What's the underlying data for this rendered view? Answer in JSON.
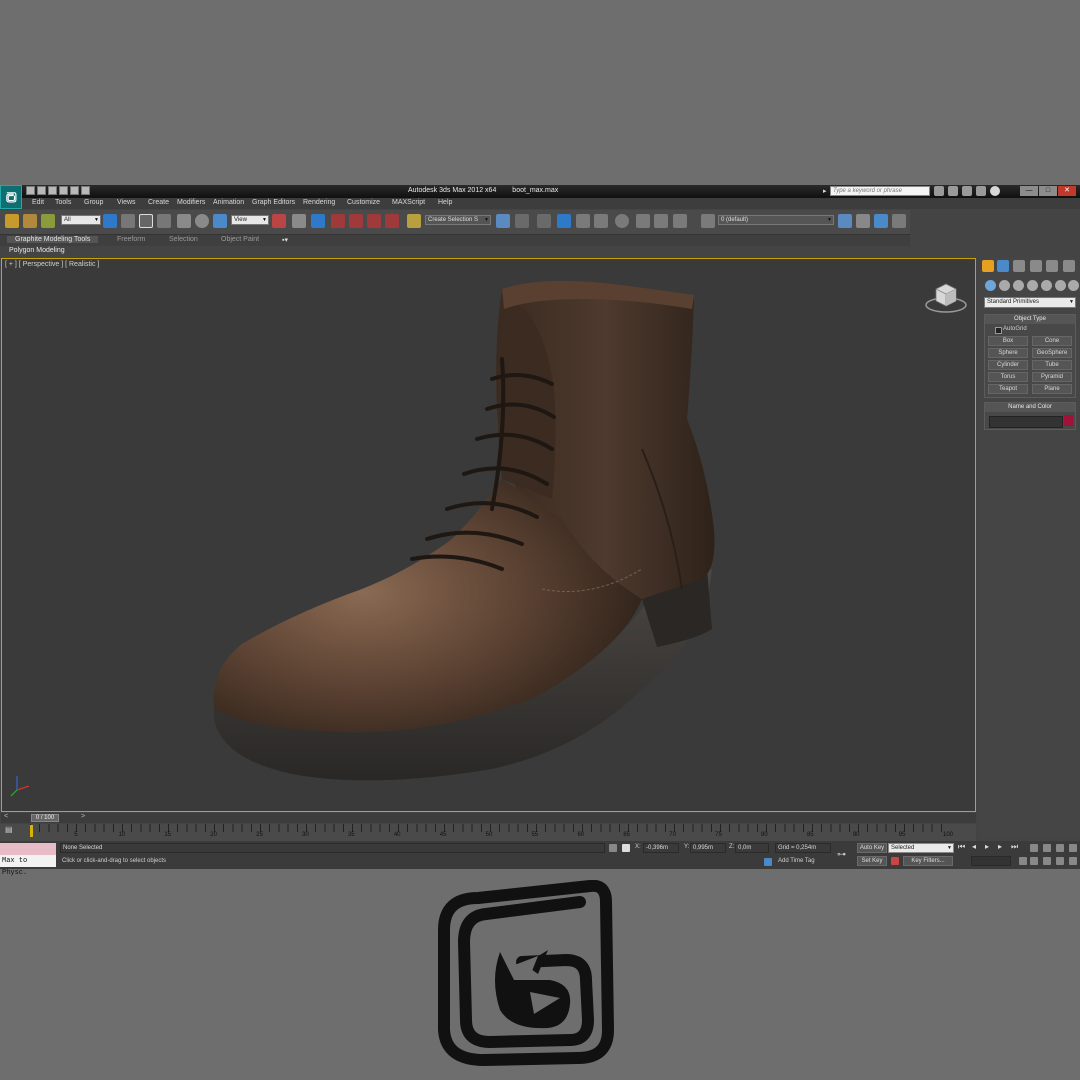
{
  "window": {
    "app_title": "Autodesk 3ds Max  2012 x64",
    "file_name": "boot_max.max",
    "search_placeholder": "Type a keyword or phrase",
    "minimize": "—",
    "maximize": "□",
    "close": "✕"
  },
  "menu": [
    "Edit",
    "Tools",
    "Group",
    "Views",
    "Create",
    "Modifiers",
    "Animation",
    "Graph Editors",
    "Rendering",
    "Customize",
    "MAXScript",
    "Help"
  ],
  "toolbar": {
    "selection_filter": "All",
    "reference_coord": "View",
    "named_selection": "Create Selection S",
    "layer": "0 (default)"
  },
  "ribbon": {
    "tabs": [
      "Graphite Modeling Tools",
      "Freeform",
      "Selection",
      "Object Paint"
    ],
    "panel_label": "Polygon Modeling"
  },
  "viewport": {
    "label": "[ + ] [ Perspective ] [ Realistic ]"
  },
  "command_panel": {
    "category": "Standard Primitives",
    "object_type_title": "Object Type",
    "autogrid_label": "AutoGrid",
    "objects": [
      "Box",
      "Cone",
      "Sphere",
      "GeoSphere",
      "Cylinder",
      "Tube",
      "Torus",
      "Pyramid",
      "Teapot",
      "Plane"
    ],
    "name_color_title": "Name and Color",
    "object_color": "#a0123a"
  },
  "timeline": {
    "frame_display": "0 / 100",
    "prev": "<",
    "next": ">",
    "ticks": [
      "5",
      "10",
      "15",
      "20",
      "25",
      "30",
      "35",
      "40",
      "45",
      "50",
      "55",
      "60",
      "65",
      "70",
      "75",
      "80",
      "85",
      "90",
      "95",
      "100"
    ]
  },
  "status": {
    "listener_text": "Max to Physc.",
    "selection_status": "None Selected",
    "prompt": "Click or click-and-drag to select objects",
    "x_label": "X:",
    "x_value": "-0,396m",
    "y_label": "Y:",
    "y_value": "0,995m",
    "z_label": "Z:",
    "z_value": "0,0m",
    "grid": "Grid = 0,254m",
    "add_time_tag": "Add Time Tag",
    "auto_key": "Auto Key",
    "set_key": "Set Key",
    "key_mode": "Selected",
    "key_filters": "Key Filters..."
  },
  "colors": {
    "viewport_border": "#c9a300",
    "app_logo_bg": "#0e6f73"
  }
}
